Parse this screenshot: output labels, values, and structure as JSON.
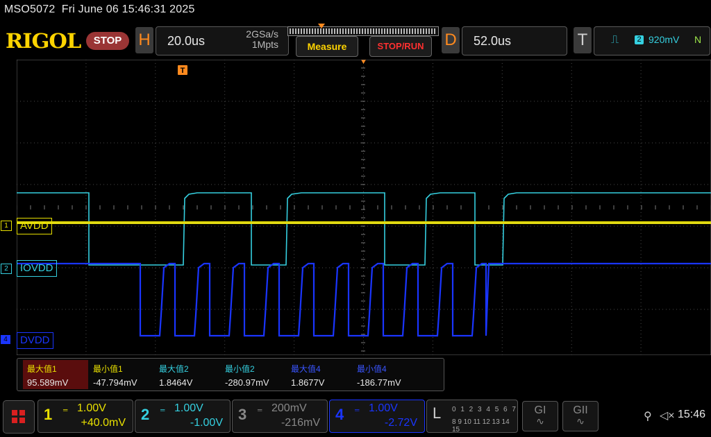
{
  "topbar": {
    "model": "MSO5072",
    "datetime": "Fri June 06 15:46:31 2025"
  },
  "toolbar": {
    "logo": "RIGOL",
    "run_status": "STOP",
    "horizontal_key": "H",
    "timebase": "20.0us",
    "sample_rate": "2GSa/s",
    "memory_depth": "1Mpts",
    "measure_label": "Measure",
    "stoprun_label": "STOP/RUN",
    "delay_key": "D",
    "delay": "52.0us",
    "trigger_key": "T",
    "trigger_source": "2",
    "trigger_level": "920mV",
    "trigger_mode": "N"
  },
  "channels": {
    "ch1": {
      "marker": "1",
      "label": "AVDD",
      "color": "#e8e000"
    },
    "ch2": {
      "marker": "2",
      "label": "IOVDD",
      "color": "#35d0e0"
    },
    "ch4": {
      "marker": "4",
      "label": "DVDD",
      "color": "#1a35ff"
    }
  },
  "measurements": [
    {
      "label": "最大值1",
      "value": "95.589mV",
      "color": "#e8e000",
      "highlight": true
    },
    {
      "label": "最小值1",
      "value": "-47.794mV",
      "color": "#e8e000",
      "highlight": false
    },
    {
      "label": "最大值2",
      "value": "1.8464V",
      "color": "#35d0e0",
      "highlight": false
    },
    {
      "label": "最小值2",
      "value": "-280.97mV",
      "color": "#35d0e0",
      "highlight": false
    },
    {
      "label": "最大值4",
      "value": "1.8677V",
      "color": "#3a55ff",
      "highlight": false
    },
    {
      "label": "最小值4",
      "value": "-186.77mV",
      "color": "#3a55ff",
      "highlight": false
    }
  ],
  "bottom": {
    "ch1": {
      "num": "1",
      "scale": "1.00V",
      "offset": "+40.0mV",
      "color": "#e8e000"
    },
    "ch2": {
      "num": "2",
      "scale": "1.00V",
      "offset": "-1.00V",
      "color": "#35d0e0"
    },
    "ch3": {
      "num": "3",
      "scale": "200mV",
      "offset": "-216mV",
      "color": "#888888"
    },
    "ch4": {
      "num": "4",
      "scale": "1.00V",
      "offset": "-2.72V",
      "color": "#1a35ff"
    },
    "logic_key": "L",
    "logic_row1": "0 1 2 3   4 5 6 7",
    "logic_row2": "8 9 10 11 12 13 14 15",
    "gen1": "GI",
    "gen2": "GII",
    "clock": "15:46"
  }
}
